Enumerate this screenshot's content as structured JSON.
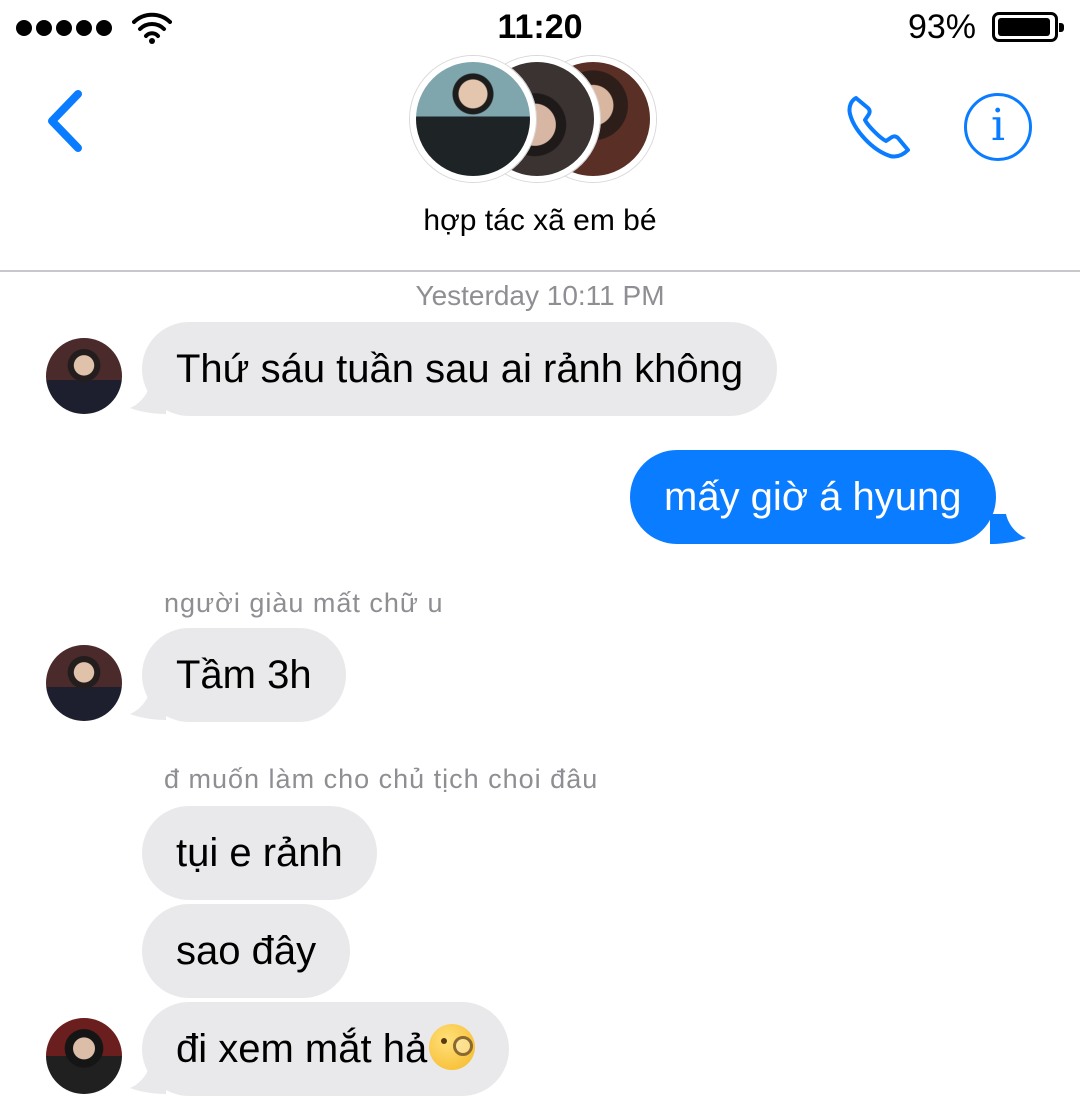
{
  "status_bar": {
    "time": "11:20",
    "battery_percent": "93%",
    "signal_bars": 5,
    "battery_level": 0.93
  },
  "header": {
    "group_name": "hợp tác xã em bé",
    "icons": [
      "back-chevron-icon",
      "phone-icon",
      "info-icon"
    ],
    "info_glyph": "i"
  },
  "conversation": {
    "timestamp": "Yesterday 10:11 PM",
    "messages": [
      {
        "direction": "incoming",
        "text": "Thứ sáu tuần sau ai rảnh không"
      },
      {
        "direction": "outgoing",
        "text": "mấy giờ á hyung"
      },
      {
        "direction": "incoming",
        "sender": "người giàu mất chữ u",
        "text": "Tầm 3h"
      },
      {
        "direction": "incoming",
        "sender": "đ muốn làm cho chủ tịch choi đâu",
        "text": "tụi e rảnh"
      },
      {
        "direction": "incoming",
        "text": "sao đây"
      },
      {
        "direction": "incoming",
        "text": "đi xem mắt hả",
        "emoji": "face-with-monocle"
      }
    ]
  },
  "colors": {
    "accent": "#0a7cff",
    "incoming_bubble": "#e9e9eb",
    "outgoing_bubble": "#0a7cff",
    "meta_text": "#8e8e93",
    "divider": "#c8c8cc"
  }
}
